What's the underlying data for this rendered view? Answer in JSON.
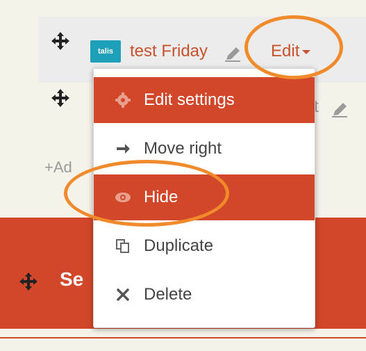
{
  "activity": {
    "badge_text": "talis",
    "name": "test Friday",
    "edit_label": "Edit",
    "second_name_fragment": "st",
    "add_label": "Ad"
  },
  "section": {
    "title_fragment": "Se"
  },
  "menu": {
    "items": [
      {
        "label": "Edit settings",
        "icon": "gear-icon"
      },
      {
        "label": "Move right",
        "icon": "arrow-right-icon"
      },
      {
        "label": "Hide",
        "icon": "eye-icon"
      },
      {
        "label": "Duplicate",
        "icon": "duplicate-icon"
      },
      {
        "label": "Delete",
        "icon": "close-icon"
      }
    ]
  },
  "colors": {
    "accent": "#d2472a",
    "link": "#c9512b",
    "highlight_oval": "#f08a2a",
    "page_bg": "#f5f2ea",
    "badge": "#1fa0b9"
  }
}
